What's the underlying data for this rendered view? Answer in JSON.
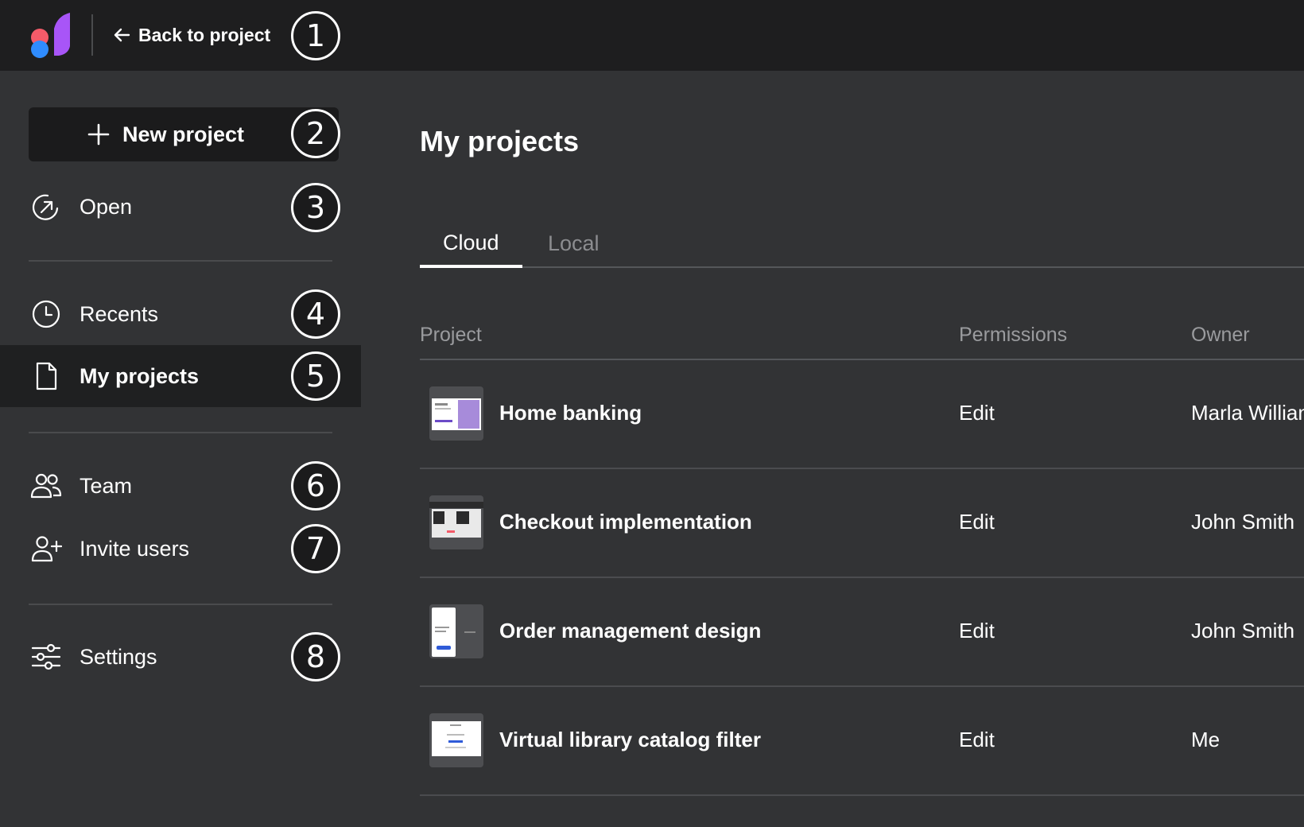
{
  "topbar": {
    "back_label": "Back to project",
    "logo_colors": [
      "#f45b69",
      "#2f8cff",
      "#a855f7"
    ]
  },
  "sidebar": {
    "new_project_label": "New project",
    "items": [
      {
        "id": "open",
        "label": "Open",
        "icon": "open-arrow-icon"
      },
      {
        "id": "recents",
        "label": "Recents",
        "icon": "clock-icon"
      },
      {
        "id": "my-projects",
        "label": "My projects",
        "icon": "document-icon",
        "active": true
      },
      {
        "id": "team",
        "label": "Team",
        "icon": "users-icon"
      },
      {
        "id": "invite-users",
        "label": "Invite users",
        "icon": "user-plus-icon"
      },
      {
        "id": "settings",
        "label": "Settings",
        "icon": "sliders-icon"
      }
    ]
  },
  "badges": [
    "1",
    "2",
    "3",
    "4",
    "5",
    "6",
    "7",
    "8"
  ],
  "main": {
    "title": "My projects",
    "tabs": [
      {
        "label": "Cloud",
        "active": true
      },
      {
        "label": "Local",
        "active": false
      }
    ],
    "table": {
      "headers": [
        "Project",
        "Permissions",
        "Owner"
      ],
      "rows": [
        {
          "name": "Home banking",
          "permission": "Edit",
          "owner": "Marla Williams"
        },
        {
          "name": "Checkout implementation",
          "permission": "Edit",
          "owner": "John Smith"
        },
        {
          "name": "Order management design",
          "permission": "Edit",
          "owner": "John Smith"
        },
        {
          "name": "Virtual library catalog filter",
          "permission": "Edit",
          "owner": "Me"
        }
      ]
    }
  }
}
